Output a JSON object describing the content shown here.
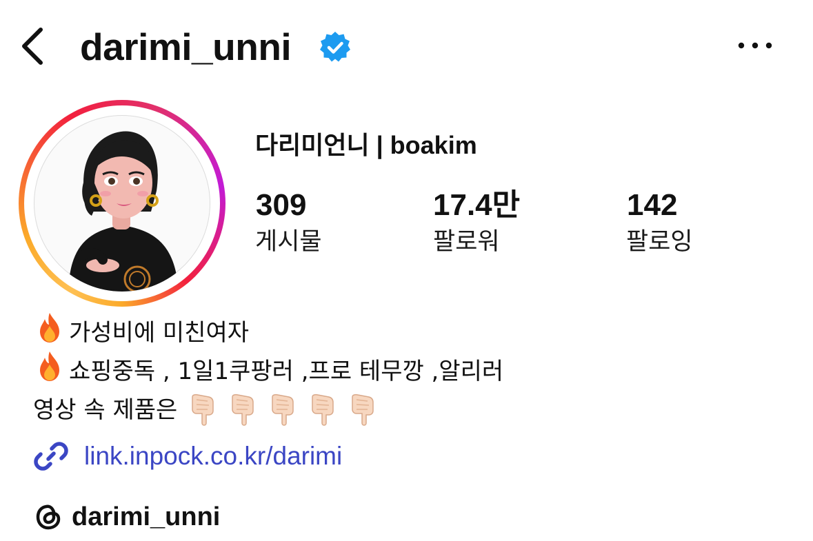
{
  "header": {
    "username": "darimi_unni",
    "verified": true
  },
  "profile": {
    "display_name": "다리미언니 | boakim",
    "stats": [
      {
        "value": "309",
        "label": "게시물"
      },
      {
        "value": "17.4만",
        "label": "팔로워"
      },
      {
        "value": "142",
        "label": "팔로잉"
      }
    ]
  },
  "bio": {
    "line1": "가성비에 미친여자",
    "line2": "쇼핑중독 , 1일1쿠팡러 ,프로 테무깡 ,알리러",
    "line3": "영상 속 제품은",
    "line1_emoji": "🔥",
    "line2_emoji": "🔥",
    "pointing_emoji_count": 5
  },
  "link": {
    "text": "link.inpock.co.kr/darimi"
  },
  "threads": {
    "handle": "darimi_unni"
  },
  "colors": {
    "link": "#3b46c4",
    "verified_badge": "#1d9bf0",
    "text": "#111111"
  },
  "icons": [
    "chevron-left-icon",
    "verified-badge-icon",
    "more-horizontal-icon",
    "fire-icon",
    "pointing-down-icon",
    "link-icon",
    "threads-icon"
  ]
}
